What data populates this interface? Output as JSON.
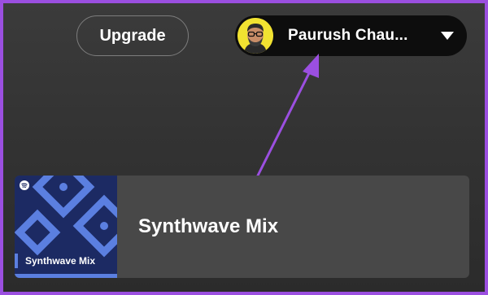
{
  "header": {
    "upgrade_label": "Upgrade",
    "profile": {
      "name": "Paurush Chau...",
      "avatar_icon": "user-avatar",
      "dropdown_icon": "caret-down-icon"
    }
  },
  "annotation": {
    "arrow_color": "#9b4fe0"
  },
  "mix_card": {
    "title": "Synthwave Mix",
    "cover_label": "Synthwave Mix",
    "cover_logo_icon": "spotify-logo-icon",
    "cover_bg": "#1c2a63",
    "cover_accent": "#5b7fe0"
  },
  "colors": {
    "frame_border": "#9b4fe0",
    "background": "#333333",
    "profile_pill": "#0d0d0d"
  }
}
